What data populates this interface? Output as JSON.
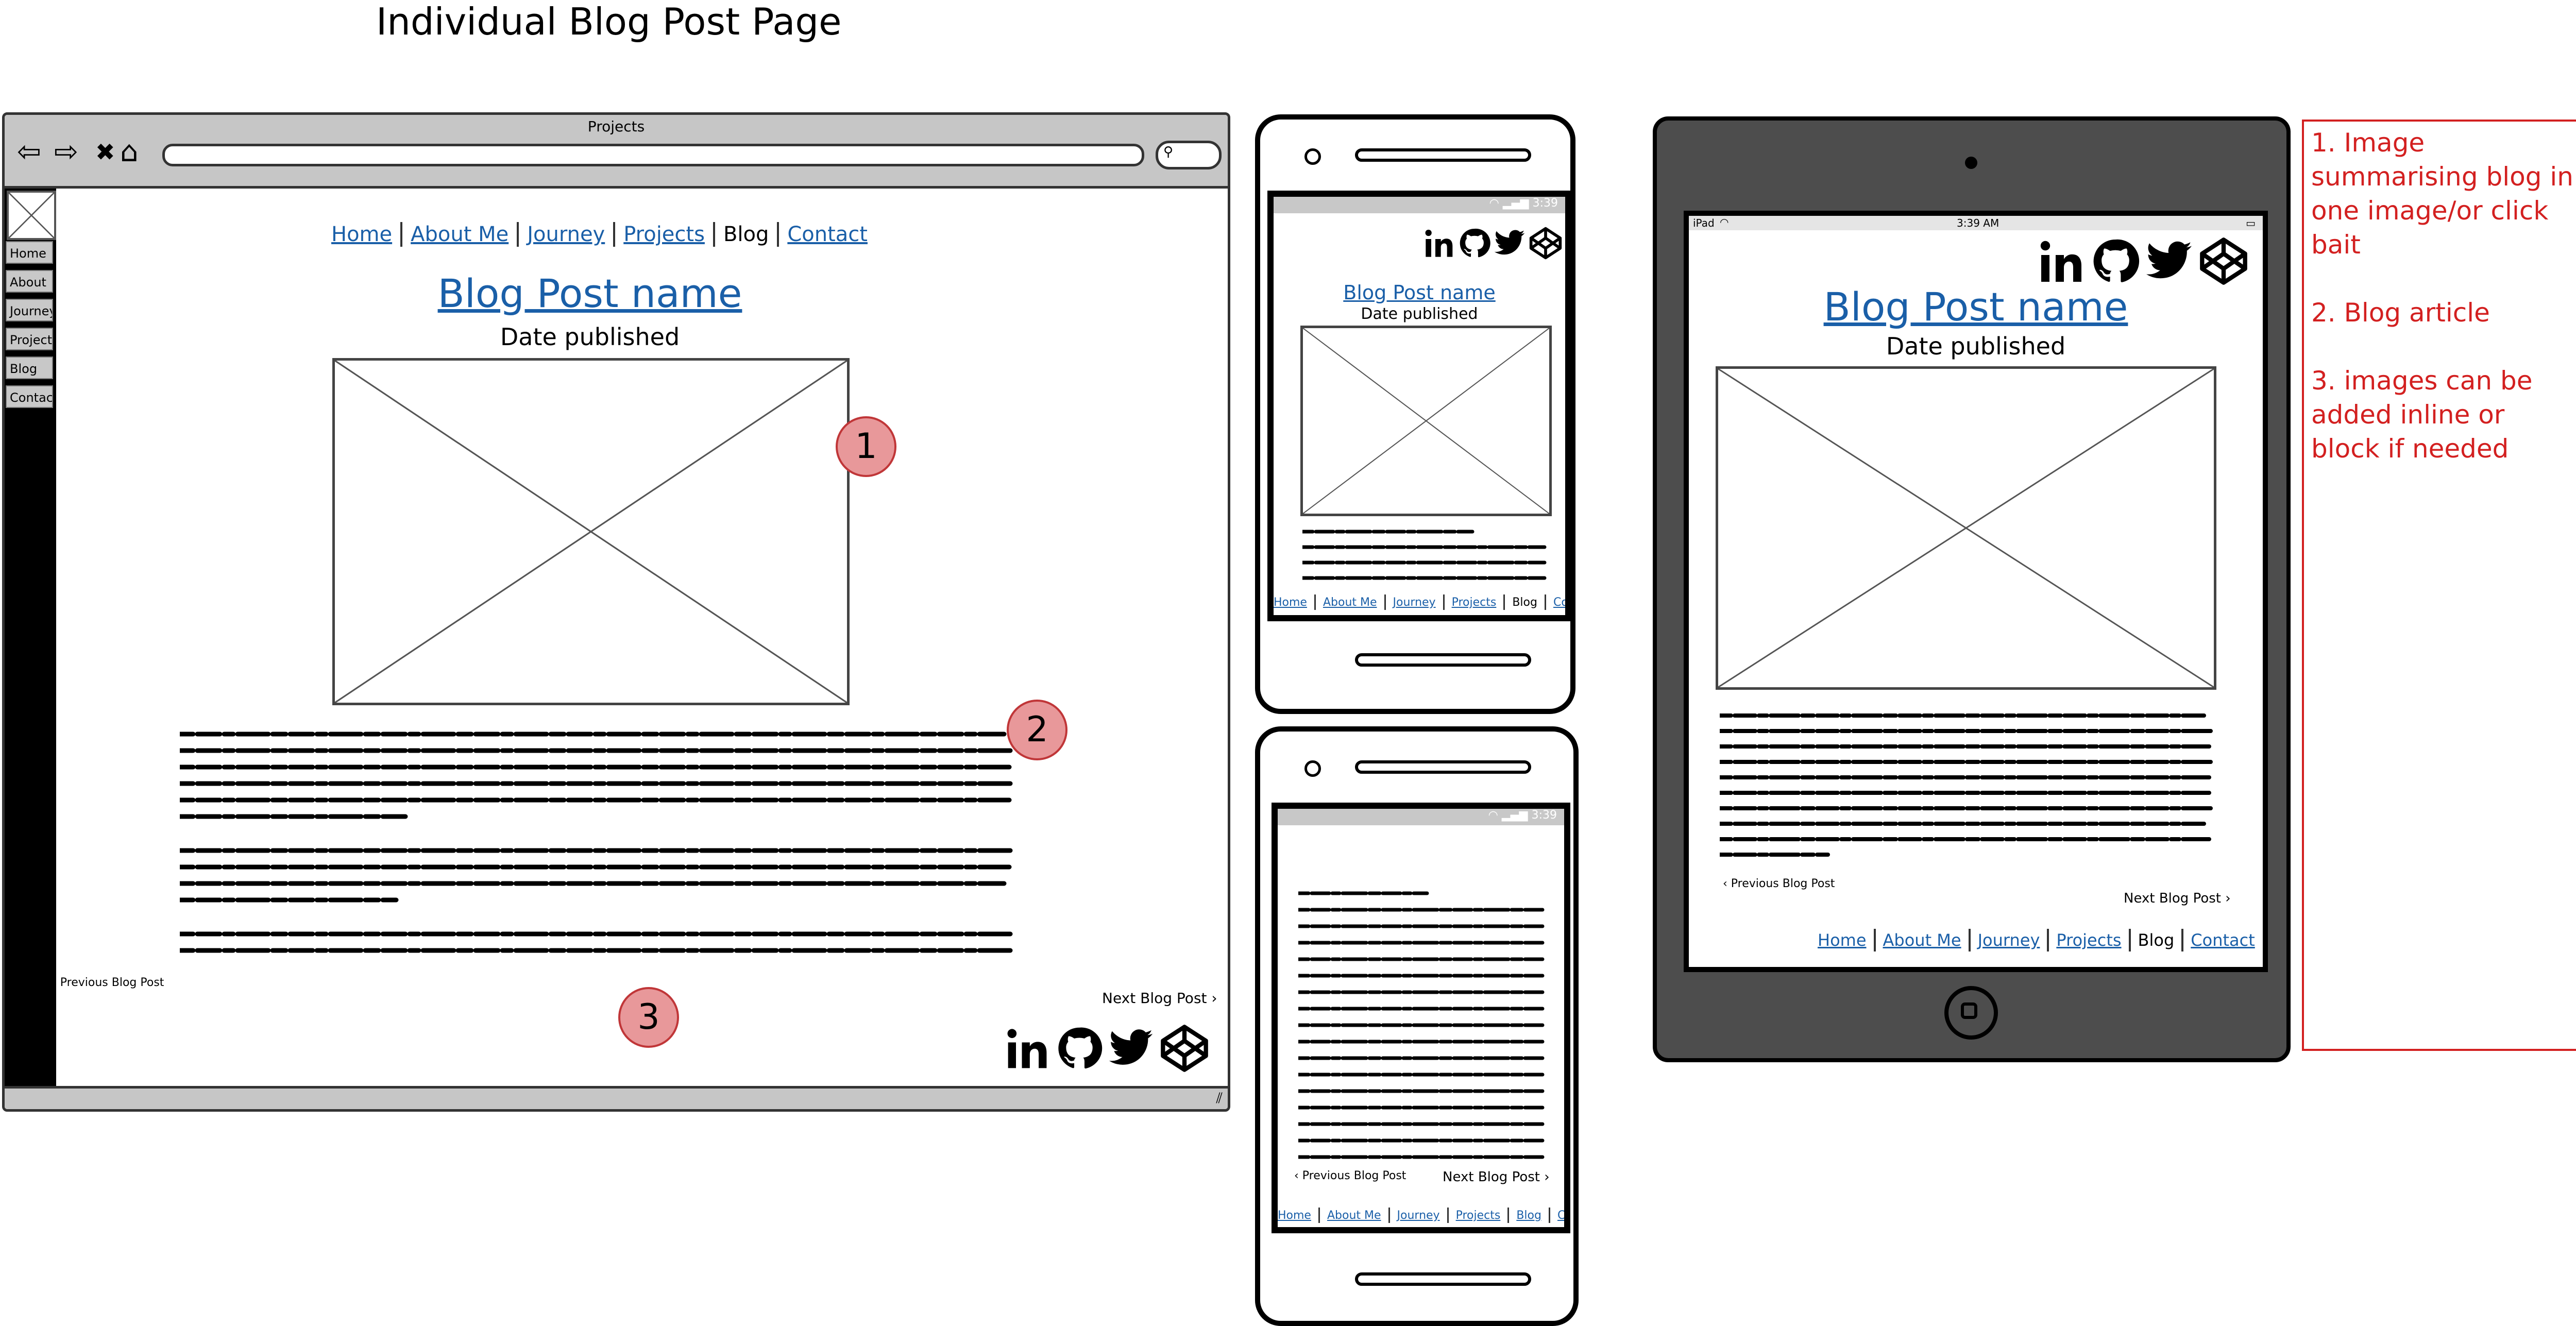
{
  "page_title": "Individual Blog Post Page",
  "desktop": {
    "window_title": "Projects",
    "sidebar": [
      "Home",
      "About",
      "Journey",
      "Projects",
      "Blog",
      "Contact"
    ],
    "nav": [
      "Home",
      "About Me",
      "Journey",
      "Projects",
      "Blog",
      "Contact"
    ],
    "heading": "Blog Post name",
    "date": "Date published",
    "prev": "Previous Blog Post",
    "next": "Next Blog Post",
    "badges": [
      "1",
      "2",
      "3"
    ]
  },
  "phone1": {
    "time": "3:39",
    "heading": "Blog Post name",
    "date": "Date published",
    "nav": [
      "Home",
      "About Me",
      "Journey",
      "Projects",
      "Blog",
      "Contact"
    ]
  },
  "phone2": {
    "time": "3:39",
    "prev": "Previous Blog Post",
    "next": "Next Blog Post",
    "nav": [
      "Home",
      "About Me",
      "Journey",
      "Projects",
      "Blog",
      "Contact"
    ]
  },
  "tablet": {
    "device": "iPad",
    "time": "3:39 AM",
    "heading": "Blog Post name",
    "date": "Date published",
    "prev": "Previous Blog Post",
    "next": "Next Blog Post",
    "nav": [
      "Home",
      "About Me",
      "Journey",
      "Projects",
      "Blog",
      "Contact"
    ]
  },
  "notes": [
    "1. Image summarising blog in one image/or click bait",
    "2. Blog article",
    "3. images can be added inline or block if needed"
  ],
  "icons": [
    "back-arrow-icon",
    "forward-arrow-icon",
    "close-icon",
    "home-icon",
    "search-icon",
    "linkedin-icon",
    "github-icon",
    "twitter-icon",
    "codepen-icon",
    "chevron-left-icon",
    "chevron-right-icon",
    "wifi-icon",
    "battery-icon",
    "resize-grip-icon"
  ],
  "colors": {
    "link": "#1a5fa8",
    "badge_fill": "#e8989a",
    "badge_border": "#c03638",
    "note_red": "#d32020",
    "tablet_body": "#4d4d4d"
  }
}
